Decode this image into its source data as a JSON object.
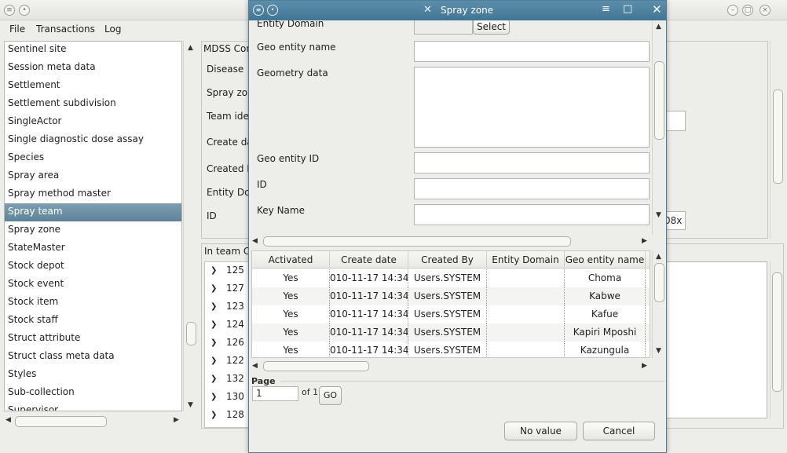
{
  "menu": [
    "File",
    "Transactions",
    "Log"
  ],
  "entity_list": [
    "Sentinel site",
    "Session meta data",
    "Settlement",
    "Settlement subdivision",
    "SingleActor",
    "Single diagnostic dose assay",
    "Species",
    "Spray area",
    "Spray method master",
    "Spray team",
    "Spray zone",
    "StateMaster",
    "Stock depot",
    "Stock event",
    "Stock item",
    "Stock staff",
    "Struct attribute",
    "Struct class meta data",
    "Styles",
    "Sub-collection",
    "Supervisor"
  ],
  "main_panel": {
    "section_title": "MDSS Con",
    "labels": [
      "Disease",
      "Spray zon",
      "Team iden",
      "Create da",
      "Created B",
      "Entity Do",
      "ID"
    ],
    "id_value_fragment": "08x",
    "in_team_label": "In team C",
    "team_values": [
      "125",
      "127",
      "123",
      "124",
      "126",
      "122",
      "132",
      "130",
      "128"
    ]
  },
  "dialog": {
    "title": "Spray zone",
    "entity_domain_label": "Entity Domain",
    "select_button": "Select",
    "fields": {
      "geo_entity_name": "Geo entity name",
      "geometry_data": "Geometry data",
      "geo_entity_id": "Geo entity ID",
      "id": "ID",
      "key_name": "Key Name"
    },
    "grid": {
      "columns": [
        "Activated",
        "Create date",
        "Created By",
        "Entity Domain",
        "Geo entity name"
      ],
      "rows": [
        [
          "Yes",
          "010-11-17 14:34:",
          "Users.SYSTEM",
          "",
          "Choma"
        ],
        [
          "Yes",
          "010-11-17 14:34:",
          "Users.SYSTEM",
          "",
          "Kabwe"
        ],
        [
          "Yes",
          "010-11-17 14:34:",
          "Users.SYSTEM",
          "",
          "Kafue"
        ],
        [
          "Yes",
          "010-11-17 14:34:",
          "Users.SYSTEM",
          "",
          "Kapiri Mposhi"
        ],
        [
          "Yes",
          "010-11-17 14:34:",
          "Users.SYSTEM",
          "",
          "Kazungula"
        ]
      ]
    },
    "page_label": "Page",
    "page_value": "1",
    "page_of": "of 1",
    "go_button": "GO",
    "no_value_button": "No value",
    "cancel_button": "Cancel"
  },
  "selected_entity": "Spray team",
  "colors": {
    "title_bar": "#4f84a2",
    "selection": "#6b8fa4",
    "window_bg": "#ededea"
  }
}
